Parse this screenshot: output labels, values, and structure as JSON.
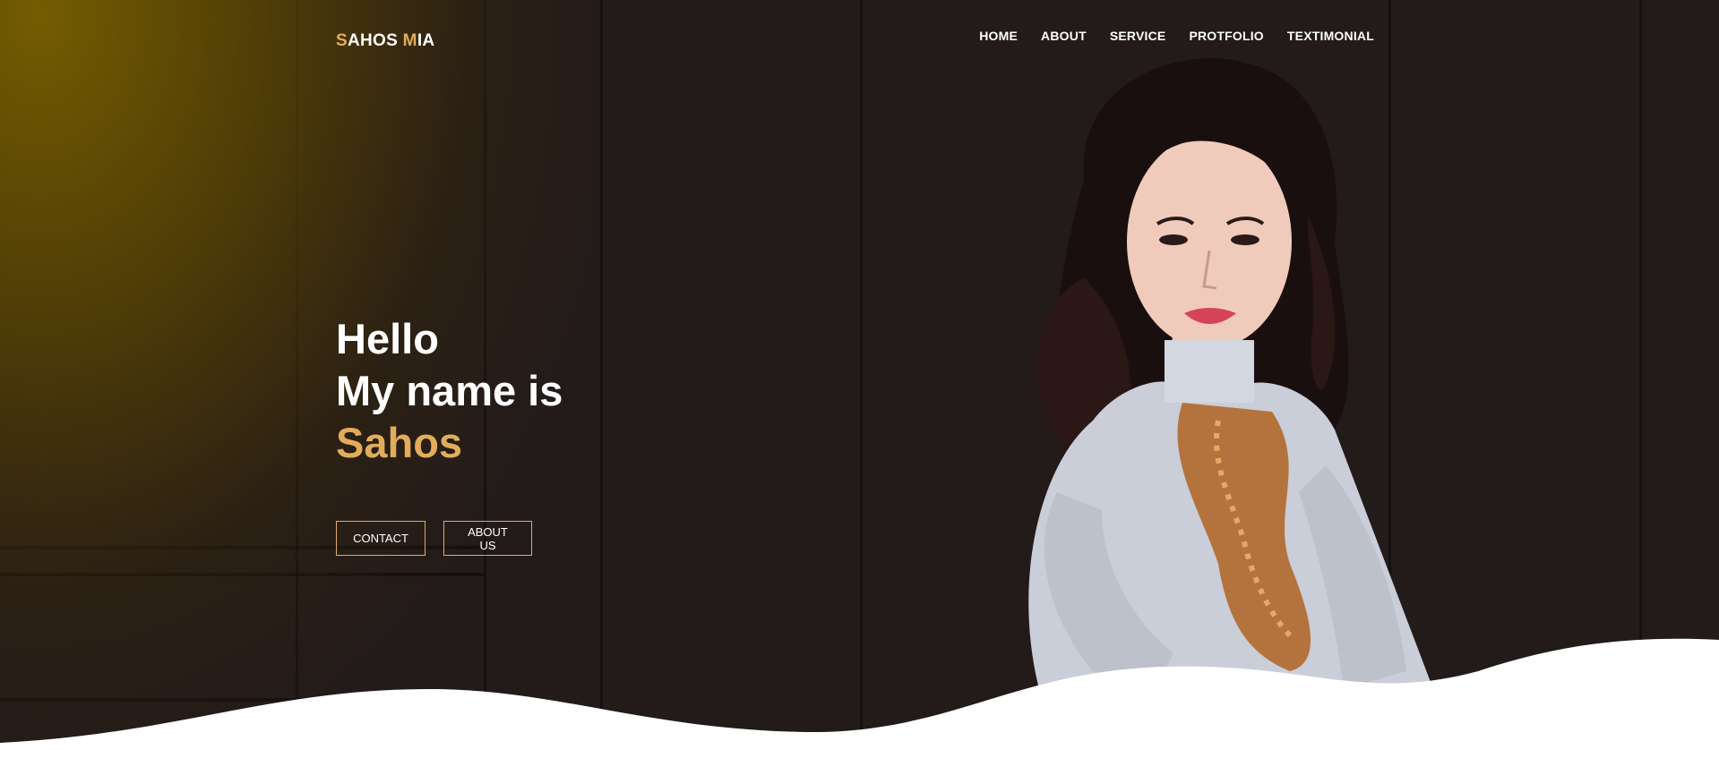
{
  "brand": {
    "first_initial": "S",
    "first_rest": "AHOS ",
    "second_initial": "M",
    "second_rest": "IA"
  },
  "nav": {
    "items": [
      {
        "label": "HOME"
      },
      {
        "label": "ABOUT"
      },
      {
        "label": "SERVICE"
      },
      {
        "label": "PROTFOLIO"
      },
      {
        "label": "TEXTIMONIAL"
      }
    ]
  },
  "hero": {
    "line1": "Hello",
    "line2": "My name is",
    "name": "Sahos",
    "contact_label": "CONTACT",
    "about_label": "ABOUT US"
  },
  "colors": {
    "accent": "#e1ad5a",
    "background": "#1e1716",
    "text": "#ffffff"
  },
  "icons": {
    "portrait": "woman-portrait-photo"
  }
}
